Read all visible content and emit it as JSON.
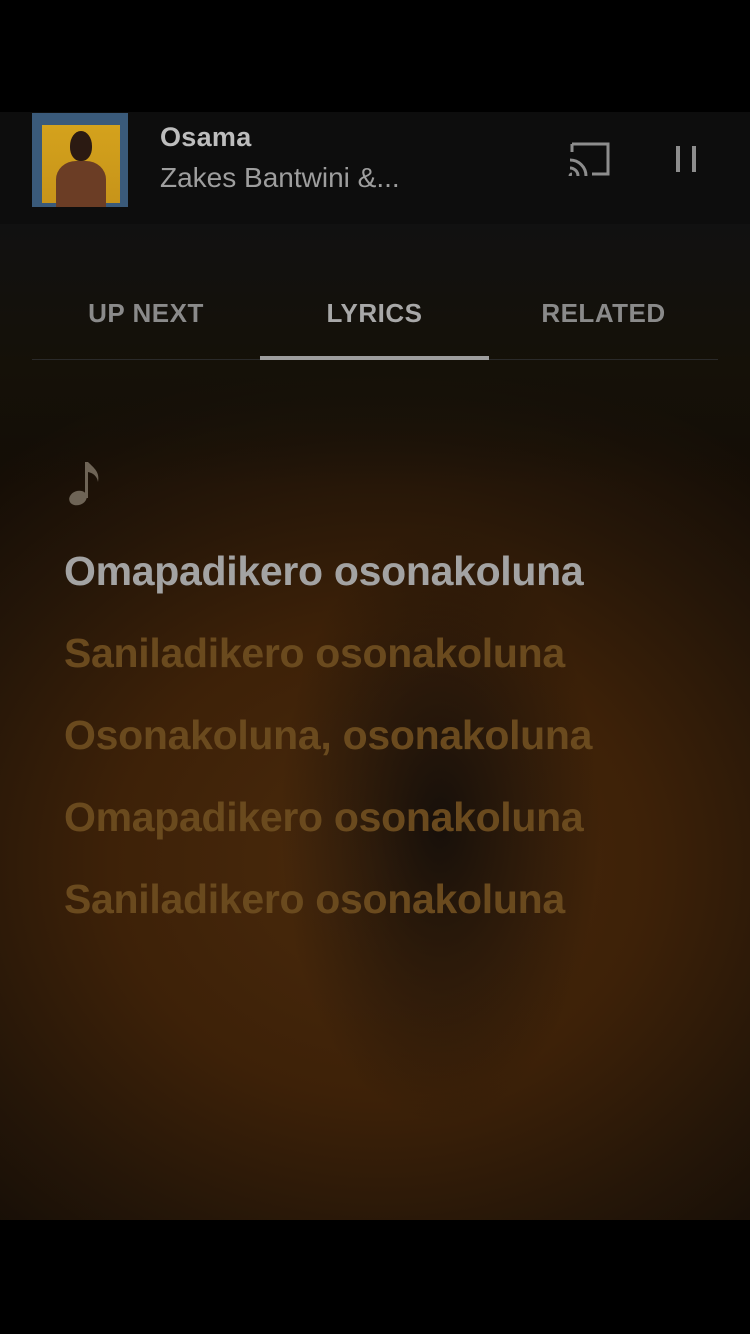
{
  "player": {
    "title": "Osama",
    "artist": "Zakes Bantwini &...",
    "album_art_icon": "album-art-image",
    "cast_icon": "cast-icon",
    "pause_icon": "pause-icon"
  },
  "tabs": [
    {
      "label": "UP NEXT",
      "active": false
    },
    {
      "label": "LYRICS",
      "active": true
    },
    {
      "label": "RELATED",
      "active": false
    }
  ],
  "lyrics": {
    "note_icon": "music-note-icon",
    "lines": [
      "Omapadikero osonakoluna",
      "Saniladikero osonakoluna",
      "Osonakoluna, osonakoluna",
      "Omapadikero osonakoluna",
      "Saniladikero osonakoluna"
    ]
  },
  "colors": {
    "background": "#000000",
    "lyric_current": "#a3a3a3",
    "lyric_upcoming": "#6a4a1e",
    "tab_indicator": "#9e9e9e"
  }
}
